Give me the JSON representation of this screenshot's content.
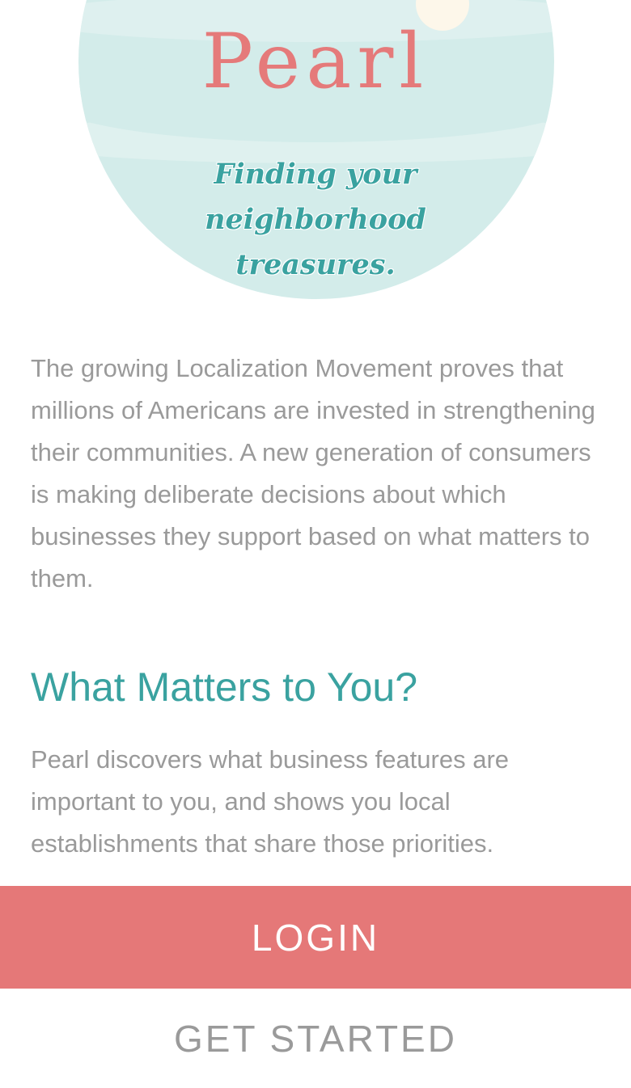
{
  "hero": {
    "title": "Pearl",
    "tagline": "Finding your neighborhood treasures."
  },
  "intro": {
    "text": "The growing Localization Movement proves that millions of Americans are invested in strengthening their communities. A new generation of consumers is making deliberate decisions about which businesses they support based on what matters to them."
  },
  "section": {
    "heading": "What Matters to You?",
    "body": "Pearl discovers what business features are important to you, and shows you local establishments that share those priorities."
  },
  "actions": {
    "login_label": "LOGIN",
    "get_started_label": "GET STARTED"
  },
  "colors": {
    "brand_coral": "#e57a7a",
    "brand_teal": "#3aa2a0",
    "body_gray": "#9a9a9a",
    "circle_aqua": "#d3ecea"
  }
}
